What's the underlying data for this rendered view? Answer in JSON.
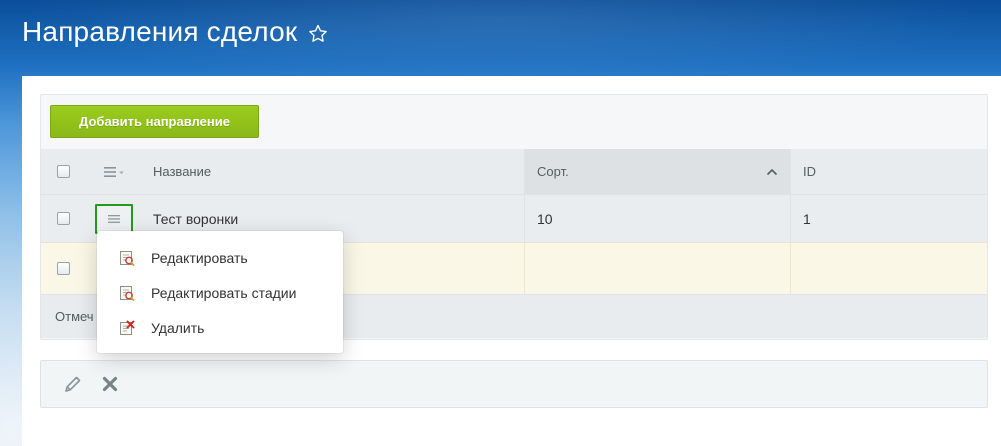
{
  "page": {
    "title": "Направления сделок",
    "favorite_icon": "star-outline-icon"
  },
  "toolbar": {
    "add_label": "Добавить направление"
  },
  "grid": {
    "columns": [
      {
        "key": "select",
        "label": ""
      },
      {
        "key": "actions",
        "label": "",
        "icon": "column-settings-icon"
      },
      {
        "key": "name",
        "label": "Название"
      },
      {
        "key": "sort",
        "label": "Сорт.",
        "sort_icon": "chevron-up-icon"
      },
      {
        "key": "id",
        "label": "ID"
      }
    ],
    "rows": [
      {
        "name": "Тест воронки",
        "sort": "10",
        "id": "1"
      },
      {
        "name": "",
        "sort": "",
        "id": ""
      }
    ],
    "footer_text": "Отмеч"
  },
  "context_menu": {
    "items": [
      {
        "label": "Редактировать",
        "icon": "edit-icon"
      },
      {
        "label": "Редактировать стадии",
        "icon": "edit-stages-icon"
      },
      {
        "label": "Удалить",
        "icon": "delete-icon"
      }
    ]
  },
  "bottom_actions": [
    {
      "icon": "pencil-icon"
    },
    {
      "icon": "close-icon"
    }
  ],
  "colors": {
    "accent_green": "#8ab81a",
    "menu_button_border": "#239a1f",
    "title_text": "#ffffff"
  }
}
